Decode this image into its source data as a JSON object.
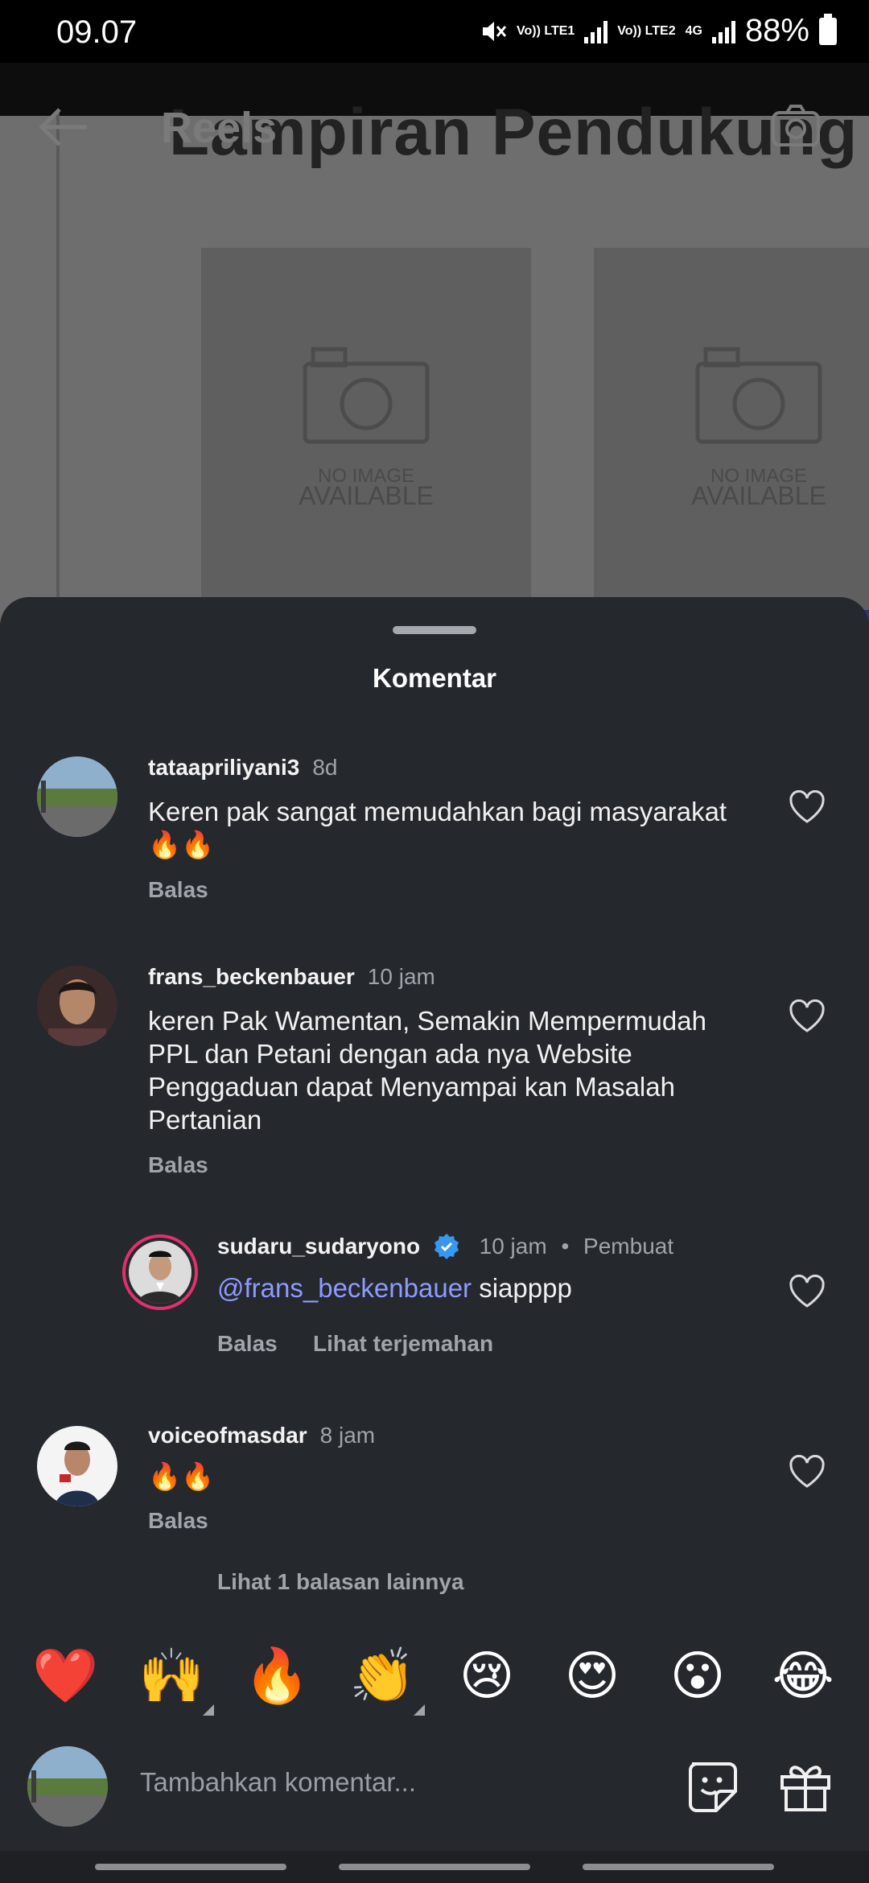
{
  "status_bar": {
    "time": "09.07",
    "sim1": "Vo)) LTE1",
    "sim2": "Vo)) LTE2",
    "network": "4G",
    "battery": "88%"
  },
  "background": {
    "screen_title": "Reels",
    "document_title": "Lampiran Pendukung",
    "placeholder_text_top": "NO IMAGE",
    "placeholder_text_bottom": "AVAILABLE"
  },
  "sheet": {
    "title": "Komentar"
  },
  "comments": [
    {
      "username": "tataapriliyani3",
      "time": "8d",
      "text": "Keren pak sangat memudahkan bagi masyarakat🔥🔥",
      "reply_label": "Balas"
    },
    {
      "username": "frans_beckenbauer",
      "time": "10 jam",
      "text": "keren Pak Wamentan, Semakin Mempermudah PPL dan Petani dengan ada nya Website Penggaduan dapat Menyampai kan Masalah Pertanian",
      "reply_label": "Balas"
    },
    {
      "username": "sudaru_sudaryono",
      "time": "10 jam",
      "creator_label": "Pembuat",
      "mention": "@frans_beckenbauer",
      "text": "siapppp",
      "reply_label": "Balas",
      "translate_label": "Lihat terjemahan"
    },
    {
      "username": "voiceofmasdar",
      "time": "8 jam",
      "text": "🔥🔥",
      "reply_label": "Balas"
    }
  ],
  "more_replies": "Lihat 1 balasan lainnya",
  "quick_emojis": [
    "❤️",
    "🙌",
    "🔥",
    "👏",
    "😢",
    "😍",
    "😮",
    "😂"
  ],
  "composer": {
    "placeholder": "Tambahkan komentar..."
  },
  "colors": {
    "sheet_bg": "#25282d",
    "secondary_text": "#a0a4ab",
    "mention": "#8e9bff",
    "verified": "#3897f0"
  }
}
